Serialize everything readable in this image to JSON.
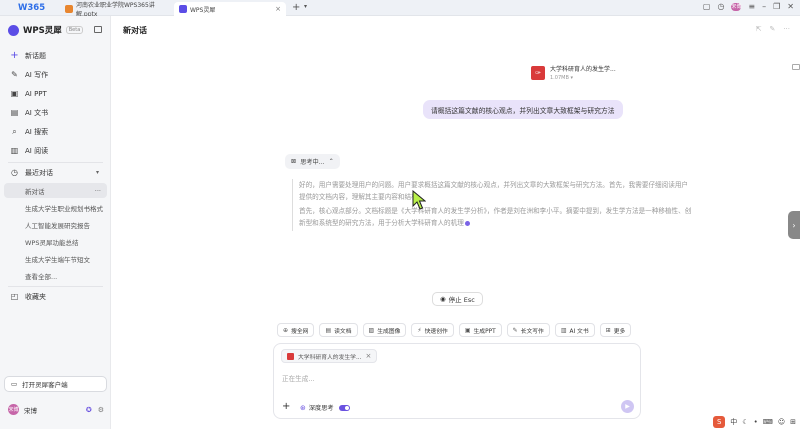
{
  "browser": {
    "logo": "W365",
    "tabs": [
      {
        "label": "河南农业职业学院WPS365讲解.pptx",
        "color": "#e8862f"
      },
      {
        "label": "WPS灵犀",
        "color": "#5b4de6"
      }
    ],
    "new_tab": "+",
    "user_avatar": "宋博"
  },
  "sidebar": {
    "brand": "WPS灵犀",
    "beta": "Beta",
    "items": [
      {
        "label": "新话题",
        "icon": "plus-icon"
      },
      {
        "label": "AI 写作",
        "icon": "pen-icon"
      },
      {
        "label": "AI PPT",
        "icon": "ppt-icon"
      },
      {
        "label": "AI 文书",
        "icon": "doc-icon"
      },
      {
        "label": "AI 搜索",
        "icon": "search-icon"
      },
      {
        "label": "AI 阅读",
        "icon": "book-icon"
      }
    ],
    "recent_label": "最近对话",
    "recent": [
      "新对话",
      "生成大学生职业规划书格式",
      "人工智能发展研究报告",
      "WPS灵犀功能总结",
      "生成大学生端午节短文",
      "查看全部..."
    ],
    "favorites": "收藏夹",
    "client_button": "打开灵犀客户端",
    "user_name": "宋博",
    "user_avatar": "宋博"
  },
  "main": {
    "title": "新对话",
    "file": {
      "name": "大学科研育人的发生学...",
      "size": "1.07MB"
    },
    "user_message": "请概括这篇文献的核心观点，并列出文章大致框架与研究方法",
    "thinking_label": "思考中...",
    "thinking_text": [
      "好的，用户需要处理用户的问题。用户要求概括这篇文献的核心观点，并列出文章的大致框架与研究方法。首先，我需要仔细阅读用户提供的文档内容，理解其主要内容和结构。",
      "首先，核心观点部分。文档标题是《大学科研育人的发生学分析》，作者是刘在洲和李小平。摘要中提到，发生学方法是一种移植性、创新型和系统型的研究方法，用于分析大学科研育人的机理"
    ],
    "stop_label": "停止 Esc",
    "tools": [
      {
        "label": "搜全网",
        "icon": "globe-icon"
      },
      {
        "label": "读文档",
        "icon": "doc-icon"
      },
      {
        "label": "生成图像",
        "icon": "image-icon"
      },
      {
        "label": "快速创作",
        "icon": "lightning-icon"
      },
      {
        "label": "生成PPT",
        "icon": "ppt-icon"
      },
      {
        "label": "长文写作",
        "icon": "long-text-icon"
      },
      {
        "label": "AI 文书",
        "icon": "file-icon"
      },
      {
        "label": "更多",
        "icon": "grid-icon"
      }
    ],
    "composer": {
      "attachment": "大学科研育人的发生学...",
      "placeholder": "正在生成...",
      "deep_think": "深度思考"
    }
  },
  "ime": {
    "label": "中"
  }
}
